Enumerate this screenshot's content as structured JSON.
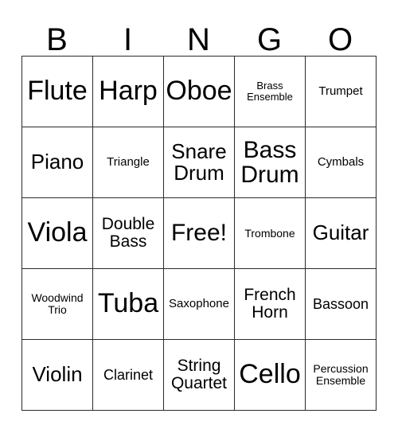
{
  "card": {
    "header_letters": [
      "B",
      "I",
      "N",
      "G",
      "O"
    ],
    "background_color": "#ffffff",
    "border_color": "#2b2b2b",
    "text_color": "#000000",
    "rows": [
      [
        {
          "text": "Flute",
          "size": "fs-xxl"
        },
        {
          "text": "Harp",
          "size": "fs-xxl"
        },
        {
          "text": "Oboe",
          "size": "fs-xxl"
        },
        {
          "text": "Brass\nEnsemble",
          "size": "fs-tiny"
        },
        {
          "text": "Trumpet",
          "size": "fs-xs"
        }
      ],
      [
        {
          "text": "Piano",
          "size": "fs-lg"
        },
        {
          "text": "Triangle",
          "size": "fs-xs"
        },
        {
          "text": "Snare\nDrum",
          "size": "fs-lg"
        },
        {
          "text": "Bass\nDrum",
          "size": "fs-xl"
        },
        {
          "text": "Cymbals",
          "size": "fs-xs"
        }
      ],
      [
        {
          "text": "Viola",
          "size": "fs-xxl"
        },
        {
          "text": "Double\nBass",
          "size": "fs-md"
        },
        {
          "text": "Free!",
          "size": "fs-xl"
        },
        {
          "text": "Trombone",
          "size": "fs-xxs"
        },
        {
          "text": "Guitar",
          "size": "fs-lg"
        }
      ],
      [
        {
          "text": "Woodwind\nTrio",
          "size": "fs-xxs"
        },
        {
          "text": "Tuba",
          "size": "fs-xxl"
        },
        {
          "text": "Saxophone",
          "size": "fs-xs"
        },
        {
          "text": "French\nHorn",
          "size": "fs-md"
        },
        {
          "text": "Bassoon",
          "size": "fs-sm"
        }
      ],
      [
        {
          "text": "Violin",
          "size": "fs-lg"
        },
        {
          "text": "Clarinet",
          "size": "fs-sm"
        },
        {
          "text": "String\nQuartet",
          "size": "fs-md"
        },
        {
          "text": "Cello",
          "size": "fs-xxl"
        },
        {
          "text": "Percussion\nEnsemble",
          "size": "fs-xxs"
        }
      ]
    ]
  }
}
